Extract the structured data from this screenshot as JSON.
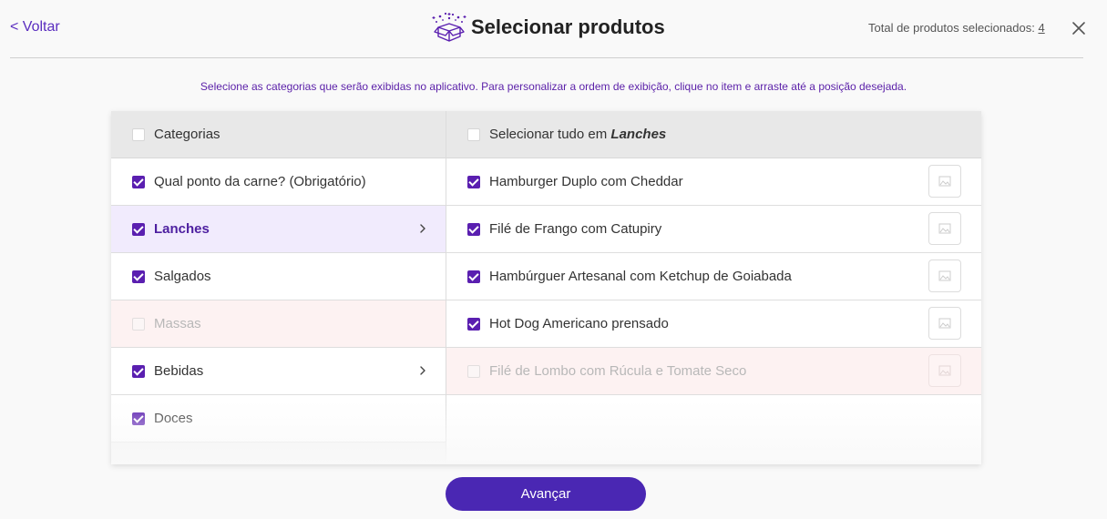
{
  "header": {
    "back_label": "<  Voltar",
    "title": "Selecionar produtos",
    "total_label": "Total de produtos selecionados:",
    "total_count": "4"
  },
  "instructions": "Selecione as categorias que serão exibidas no aplicativo. Para personalizar a ordem de exibição, clique no item e arraste até a posição desejada.",
  "categories": {
    "header_label": "Categorias",
    "items": [
      {
        "label": "Qual ponto da carne? (Obrigatório)",
        "checked": true
      },
      {
        "label": "Lanches",
        "checked": true,
        "active": true,
        "has_arrow": true
      },
      {
        "label": "Salgados",
        "checked": true
      },
      {
        "label": "Massas",
        "checked": false,
        "disabled": true
      },
      {
        "label": "Bebidas",
        "checked": true,
        "has_arrow": true
      },
      {
        "label": "Doces",
        "checked": true
      }
    ]
  },
  "products": {
    "header_prefix": "Selecionar tudo em",
    "header_category": "Lanches",
    "items": [
      {
        "label": "Hamburger Duplo com Cheddar",
        "checked": true
      },
      {
        "label": "Filé de Frango com Catupiry",
        "checked": true
      },
      {
        "label": "Hambúrguer Artesanal com Ketchup de Goiabada",
        "checked": true
      },
      {
        "label": "Hot Dog Americano prensado",
        "checked": true
      },
      {
        "label": "Filé de Lombo com Rúcula e Tomate Seco",
        "checked": false,
        "disabled": true
      }
    ]
  },
  "footer": {
    "advance_label": "Avançar"
  },
  "colors": {
    "accent": "#5a1fb0",
    "button": "#4a27b3",
    "active_row": "#f1ebfd",
    "disabled_row": "#fdf2f2"
  },
  "icons": {
    "title": "box-sparkles-icon",
    "close": "close-icon",
    "chevron": "chevron-right-icon",
    "image": "image-placeholder-icon"
  }
}
